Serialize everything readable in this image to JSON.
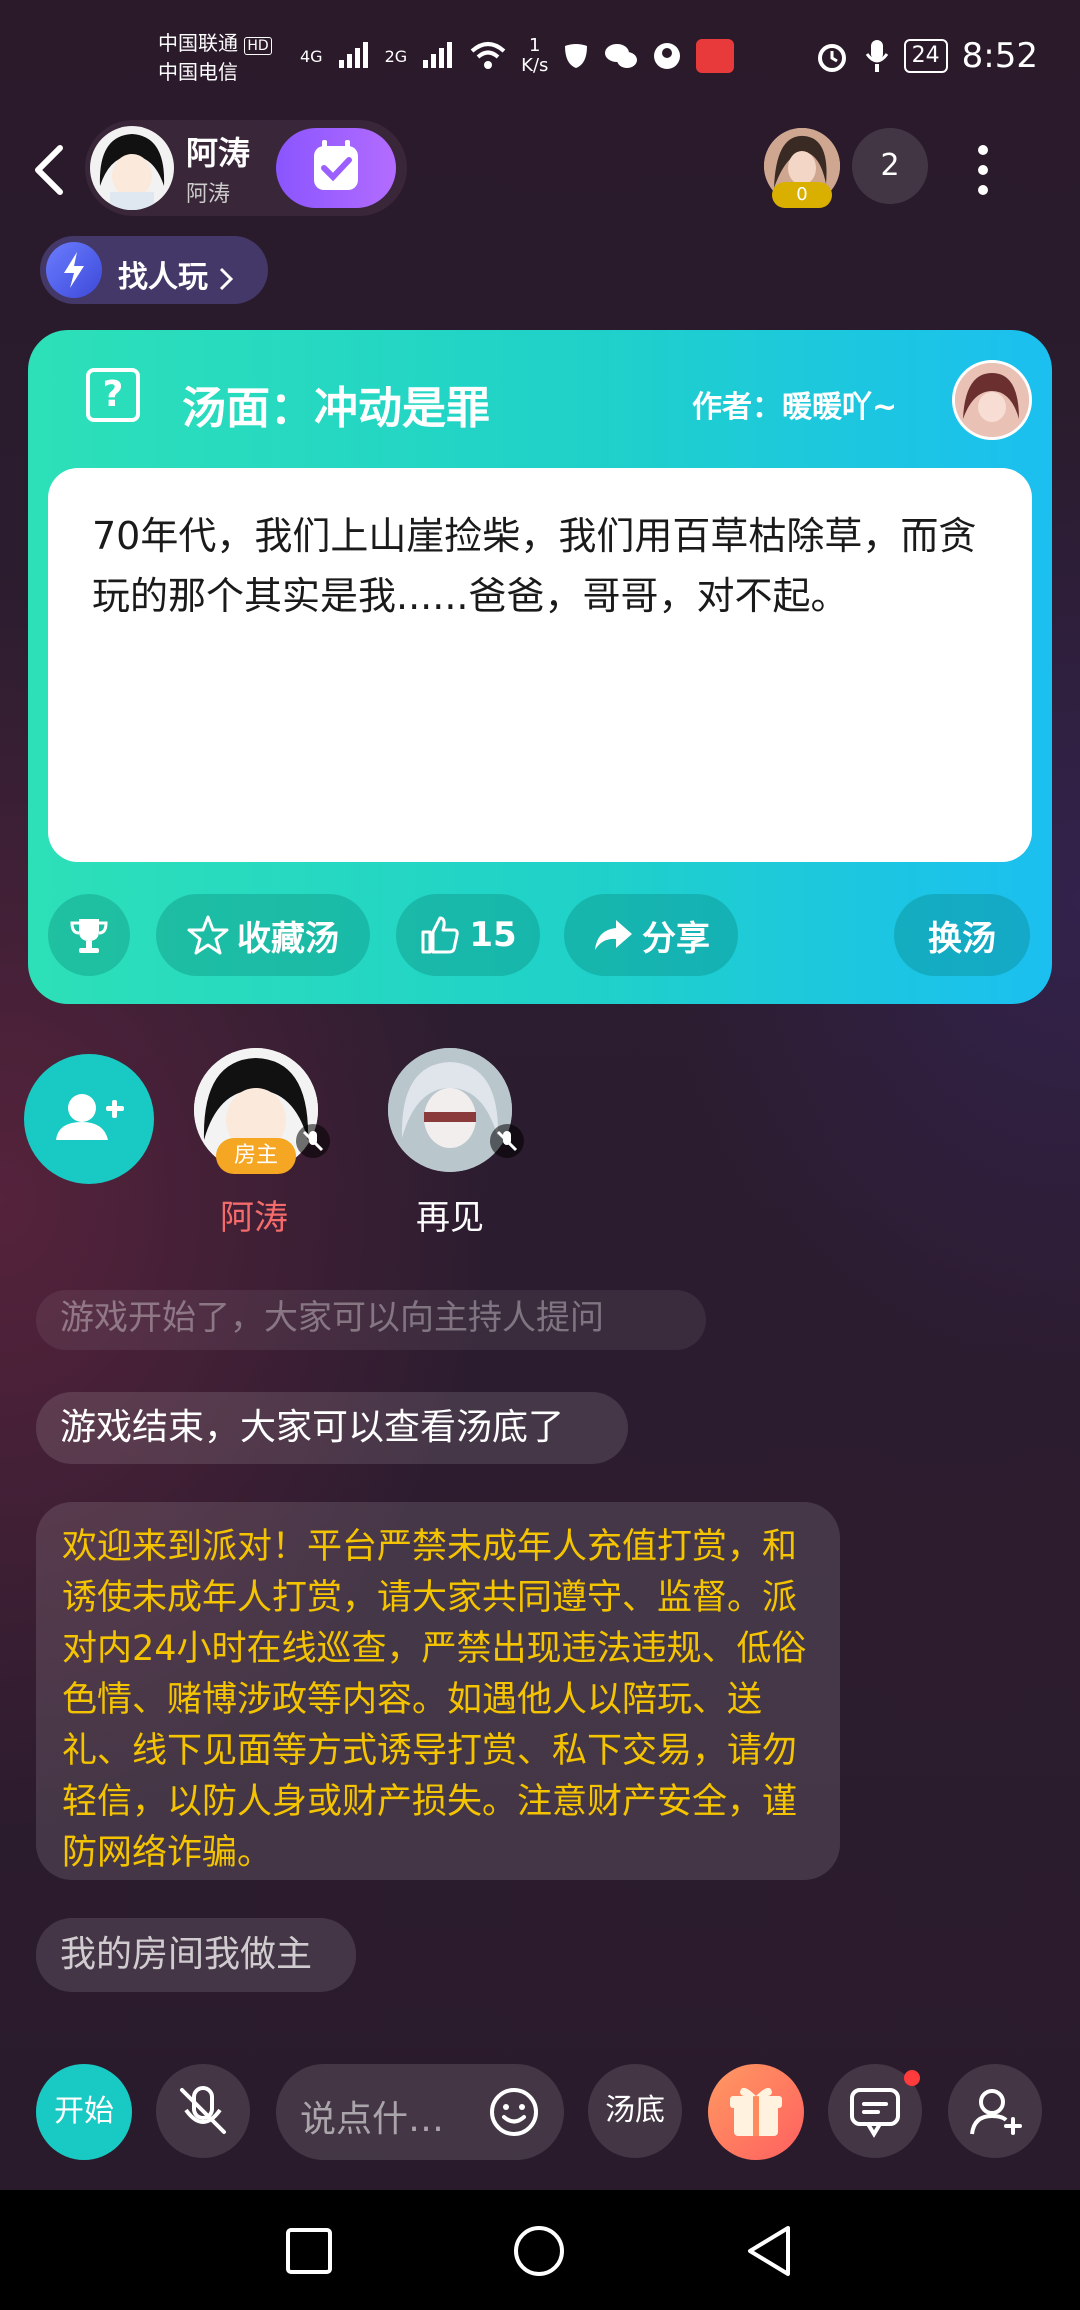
{
  "status_bar": {
    "carrier_line1": "中国联通",
    "carrier_line1_badge": "HD",
    "carrier_line2": "中国电信",
    "net1": "4G",
    "net2": "2G",
    "speed_value": "1",
    "speed_unit": "K/s",
    "battery": "24",
    "time": "8:52"
  },
  "header": {
    "host_name": "阿涛",
    "host_subname": "阿涛",
    "audience_coins": "0",
    "online_count": "2"
  },
  "find_players": {
    "label": "找人玩"
  },
  "puzzle": {
    "title": "汤面：冲动是罪",
    "author_label": "作者：暖暖吖~",
    "story": "70年代，我们上山崖捡柴，我们用百草枯除草，而贪玩的那个其实是我......爸爸，哥哥，对不起。",
    "favorite_label": "收藏汤",
    "like_count": "15",
    "share_label": "分享",
    "change_label": "换汤"
  },
  "seats": [
    {
      "name": "阿涛",
      "badge": "房主"
    },
    {
      "name": "再见"
    }
  ],
  "chat": {
    "faded_message": "游戏开始了，大家可以向主持人提问",
    "messages": [
      "游戏结束，大家可以查看汤底了",
      "欢迎来到派对！平台严禁未成年人充值打赏，和诱使未成年人打赏，请大家共同遵守、监督。派对内24小时在线巡查，严禁出现违法违规、低俗色情、赌博涉政等内容。如遇他人以陪玩、送礼、线下见面等方式诱导打赏、私下交易，请勿轻信，以防人身或财产损失。注意财产安全，谨防网络诈骗。",
      "我的房间我做主"
    ]
  },
  "bottom_bar": {
    "start_label": "开始",
    "input_placeholder": "说点什…",
    "answer_label": "汤底"
  },
  "colors": {
    "accent_teal": "#19c9c4",
    "system_msg_yellow": "#f5c400",
    "owner_name": "#f46b6b"
  }
}
